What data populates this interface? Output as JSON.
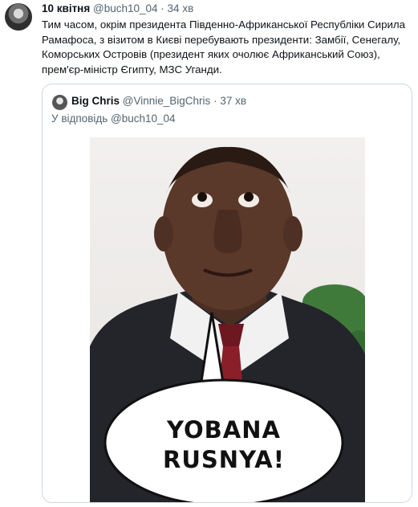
{
  "tweet": {
    "author_name": "10 квітня",
    "handle": "@buch10_04",
    "separator": "·",
    "time": "34 хв",
    "text": "Тим часом, окрім президента Південно-Африканської Республіки Сирила Рамафоса, з візитом в Києві перебувають президенти: Замбії, Сенегалу, Коморських Островів (президент яких очолює Африканський Союз), прем'єр-міністр Єгипту, МЗС Уганди."
  },
  "quoted_tweet": {
    "author_name": "Big Chris",
    "handle": "@Vinnie_BigChris",
    "separator": "·",
    "time": "37 хв",
    "reply_prefix": "У відповідь",
    "reply_handle": "@buch10_04",
    "meme_caption_line1": "YOBANA",
    "meme_caption_line2": "RUSNYA!"
  }
}
